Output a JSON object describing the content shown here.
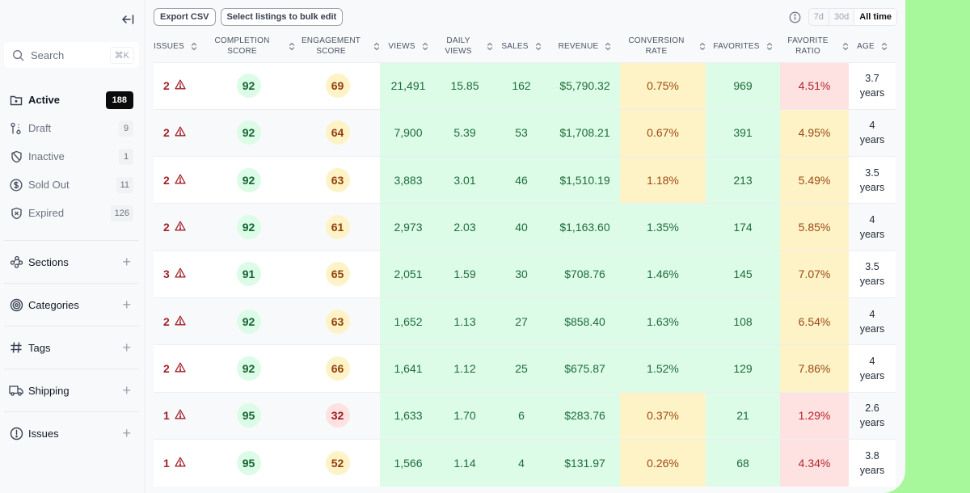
{
  "sidebar": {
    "collapse_label": "Collapse sidebar",
    "search": {
      "label": "Search",
      "shortcut": "⌘K"
    },
    "statuses": [
      {
        "label": "Active",
        "count": "188",
        "icon": "folder-icon",
        "active": true
      },
      {
        "label": "Draft",
        "count": "9",
        "icon": "draft-icon",
        "active": false
      },
      {
        "label": "Inactive",
        "count": "1",
        "icon": "shield-off-icon",
        "active": false
      },
      {
        "label": "Sold Out",
        "count": "11",
        "icon": "dollar-circle-icon",
        "active": false
      },
      {
        "label": "Expired",
        "count": "126",
        "icon": "shield-x-icon",
        "active": false
      }
    ],
    "sections": [
      {
        "label": "Sections",
        "icon": "sections-icon"
      },
      {
        "label": "Categories",
        "icon": "target-icon"
      },
      {
        "label": "Tags",
        "icon": "hash-icon"
      },
      {
        "label": "Shipping",
        "icon": "truck-icon"
      },
      {
        "label": "Issues",
        "icon": "alert-circle-icon"
      }
    ]
  },
  "toolbar": {
    "export_label": "Export CSV",
    "bulk_edit_label": "Select listings to bulk edit",
    "ranges": [
      {
        "label": "7d",
        "selected": false
      },
      {
        "label": "30d",
        "selected": false
      },
      {
        "label": "All time",
        "selected": true
      }
    ]
  },
  "table": {
    "columns": [
      {
        "key": "issues",
        "label": "ISSUES"
      },
      {
        "key": "completion",
        "label": "COMPLETION SCORE"
      },
      {
        "key": "engagement",
        "label": "ENGAGEMENT SCORE"
      },
      {
        "key": "views",
        "label": "VIEWS"
      },
      {
        "key": "daily_views",
        "label": "DAILY VIEWS"
      },
      {
        "key": "sales",
        "label": "SALES"
      },
      {
        "key": "revenue",
        "label": "REVENUE"
      },
      {
        "key": "conversion",
        "label": "CONVERSION RATE"
      },
      {
        "key": "favorites",
        "label": "FAVORITES"
      },
      {
        "key": "fav_ratio",
        "label": "FAVORITE RATIO"
      },
      {
        "key": "age",
        "label": "AGE"
      }
    ],
    "rows": [
      {
        "issues": "2",
        "completion": "92",
        "engagement": "69",
        "engagement_level": "yellow",
        "views": "21,491",
        "daily_views": "15.85",
        "sales": "162",
        "revenue": "$5,790.32",
        "conversion": "0.75%",
        "conversion_level": "yellow",
        "favorites": "969",
        "fav_ratio": "4.51%",
        "fav_ratio_level": "red",
        "age_value": "3.7",
        "age_unit": "years"
      },
      {
        "issues": "2",
        "completion": "92",
        "engagement": "64",
        "engagement_level": "yellow",
        "views": "7,900",
        "daily_views": "5.39",
        "sales": "53",
        "revenue": "$1,708.21",
        "conversion": "0.67%",
        "conversion_level": "yellow",
        "favorites": "391",
        "fav_ratio": "4.95%",
        "fav_ratio_level": "yellow",
        "age_value": "4",
        "age_unit": "years"
      },
      {
        "issues": "2",
        "completion": "92",
        "engagement": "63",
        "engagement_level": "yellow",
        "views": "3,883",
        "daily_views": "3.01",
        "sales": "46",
        "revenue": "$1,510.19",
        "conversion": "1.18%",
        "conversion_level": "yellow",
        "favorites": "213",
        "fav_ratio": "5.49%",
        "fav_ratio_level": "yellow",
        "age_value": "3.5",
        "age_unit": "years"
      },
      {
        "issues": "2",
        "completion": "92",
        "engagement": "61",
        "engagement_level": "yellow",
        "views": "2,973",
        "daily_views": "2.03",
        "sales": "40",
        "revenue": "$1,163.60",
        "conversion": "1.35%",
        "conversion_level": "green",
        "favorites": "174",
        "fav_ratio": "5.85%",
        "fav_ratio_level": "yellow",
        "age_value": "4",
        "age_unit": "years"
      },
      {
        "issues": "3",
        "completion": "91",
        "engagement": "65",
        "engagement_level": "yellow",
        "views": "2,051",
        "daily_views": "1.59",
        "sales": "30",
        "revenue": "$708.76",
        "conversion": "1.46%",
        "conversion_level": "green",
        "favorites": "145",
        "fav_ratio": "7.07%",
        "fav_ratio_level": "yellow",
        "age_value": "3.5",
        "age_unit": "years"
      },
      {
        "issues": "2",
        "completion": "92",
        "engagement": "63",
        "engagement_level": "yellow",
        "views": "1,652",
        "daily_views": "1.13",
        "sales": "27",
        "revenue": "$858.40",
        "conversion": "1.63%",
        "conversion_level": "green",
        "favorites": "108",
        "fav_ratio": "6.54%",
        "fav_ratio_level": "yellow",
        "age_value": "4",
        "age_unit": "years"
      },
      {
        "issues": "2",
        "completion": "92",
        "engagement": "66",
        "engagement_level": "yellow",
        "views": "1,641",
        "daily_views": "1.12",
        "sales": "25",
        "revenue": "$675.87",
        "conversion": "1.52%",
        "conversion_level": "green",
        "favorites": "129",
        "fav_ratio": "7.86%",
        "fav_ratio_level": "yellow",
        "age_value": "4",
        "age_unit": "years"
      },
      {
        "issues": "1",
        "completion": "95",
        "engagement": "32",
        "engagement_level": "red",
        "views": "1,633",
        "daily_views": "1.70",
        "sales": "6",
        "revenue": "$283.76",
        "conversion": "0.37%",
        "conversion_level": "yellow",
        "favorites": "21",
        "fav_ratio": "1.29%",
        "fav_ratio_level": "red",
        "age_value": "2.6",
        "age_unit": "years"
      },
      {
        "issues": "1",
        "completion": "95",
        "engagement": "52",
        "engagement_level": "yellow",
        "views": "1,566",
        "daily_views": "1.14",
        "sales": "4",
        "revenue": "$131.97",
        "conversion": "0.26%",
        "conversion_level": "yellow",
        "favorites": "68",
        "fav_ratio": "4.34%",
        "fav_ratio_level": "red",
        "age_value": "3.8",
        "age_unit": "years"
      }
    ]
  },
  "colors": {
    "good_bg": "#dcfce7",
    "warn_bg": "#fef3c7",
    "bad_bg": "#fee2e2",
    "issue_red": "#a3222a",
    "backdrop_green": "#a6f89b"
  }
}
